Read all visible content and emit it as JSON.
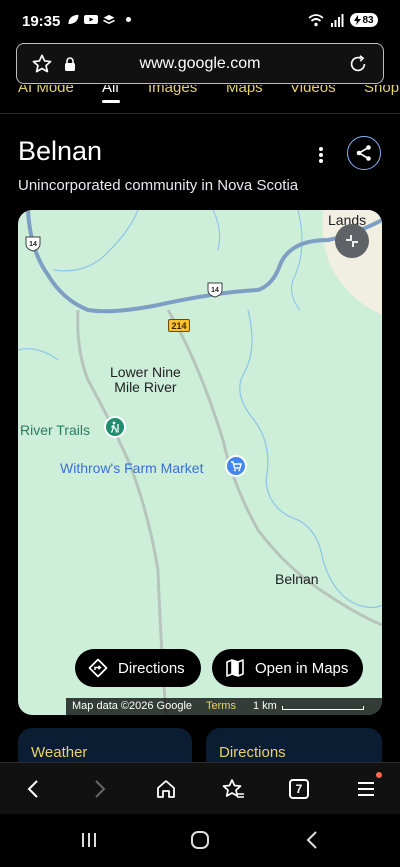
{
  "status_bar": {
    "time": "19:35",
    "battery": "83"
  },
  "url_bar": {
    "url": "www.google.com"
  },
  "search_tabs": [
    "AI Mode",
    "All",
    "Images",
    "Maps",
    "Videos",
    "Shop"
  ],
  "knowledge_panel": {
    "title": "Belnan",
    "subtitle": "Unincorporated community in Nova Scotia"
  },
  "map": {
    "labels": {
      "place": "Lower Nine\nMile River",
      "trails": "River Trails",
      "market": "Withrow's Farm Market",
      "belnan": "Belnan",
      "lands": "Lands"
    },
    "route_shields": [
      "14",
      "14",
      "214"
    ],
    "buttons": {
      "directions": "Directions",
      "open_in_maps": "Open in Maps"
    },
    "attribution": {
      "map_data": "Map data ©2026 Google",
      "terms": "Terms",
      "scale": "1 km"
    }
  },
  "cards": {
    "weather": "Weather",
    "directions": "Directions"
  },
  "toolbar": {
    "tab_count": "7"
  },
  "colors": {
    "map_land": "#cdeed9",
    "link_yellow": "#e6d26a",
    "accent_blue": "#8ab4f8"
  }
}
